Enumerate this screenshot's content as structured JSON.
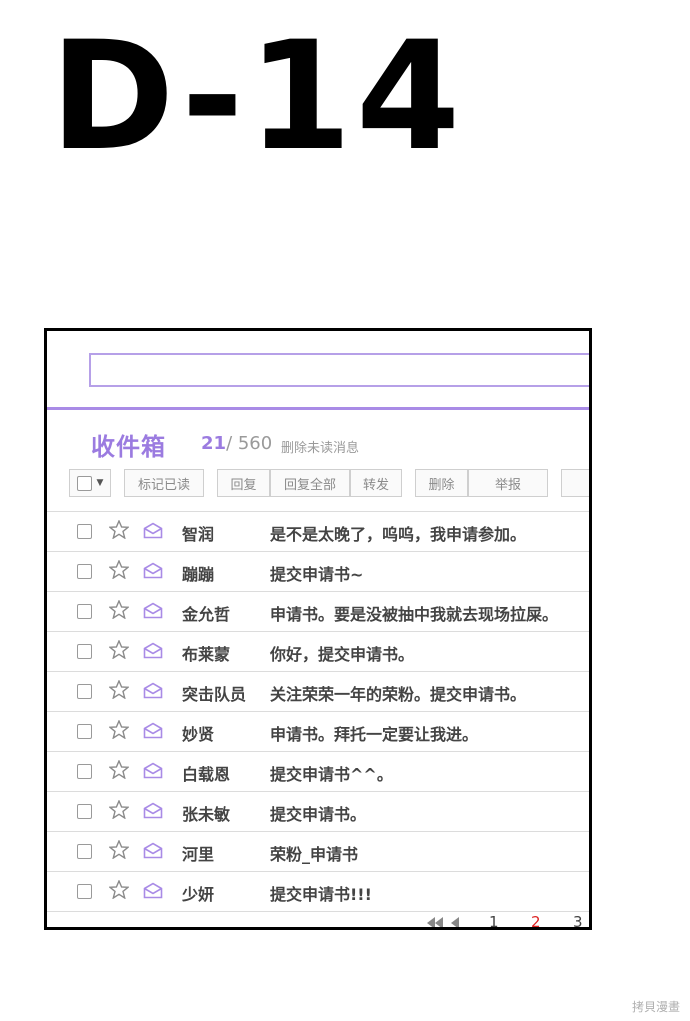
{
  "header": {
    "day_counter": "D-14"
  },
  "mail": {
    "folder_title": "收件箱",
    "unread_count": "21",
    "total_count": "/ 560",
    "delete_unread": "删除未读消息",
    "toolbar": {
      "mark_read": "标记已读",
      "reply": "回复",
      "reply_all": "回复全部",
      "forward": "转发",
      "delete": "删除",
      "report": "举报"
    },
    "messages": [
      {
        "sender": "智润",
        "subject": "是不是太晚了，呜呜，我申请参加。"
      },
      {
        "sender": "蹦蹦",
        "subject": "提交申请书~"
      },
      {
        "sender": "金允哲",
        "subject": "申请书。要是没被抽中我就去现场拉屎。"
      },
      {
        "sender": "布莱蒙",
        "subject": "你好，提交申请书。"
      },
      {
        "sender": "突击队员",
        "subject": "关注荣荣一年的荣粉。提交申请书。"
      },
      {
        "sender": "妙贤",
        "subject": "申请书。拜托一定要让我进。"
      },
      {
        "sender": "白载恩",
        "subject": "提交申请书^^。"
      },
      {
        "sender": "张未敏",
        "subject": "提交申请书。"
      },
      {
        "sender": "河里",
        "subject": "荣粉_申请书"
      },
      {
        "sender": "少妍",
        "subject": "提交申请书!!!"
      }
    ],
    "pagination": {
      "page_1": "1",
      "page_2": "2",
      "page_3": "3"
    }
  },
  "watermark": "拷貝漫畫",
  "colors": {
    "accent": "#9b7be0",
    "border": "#000000",
    "text": "#444444"
  }
}
